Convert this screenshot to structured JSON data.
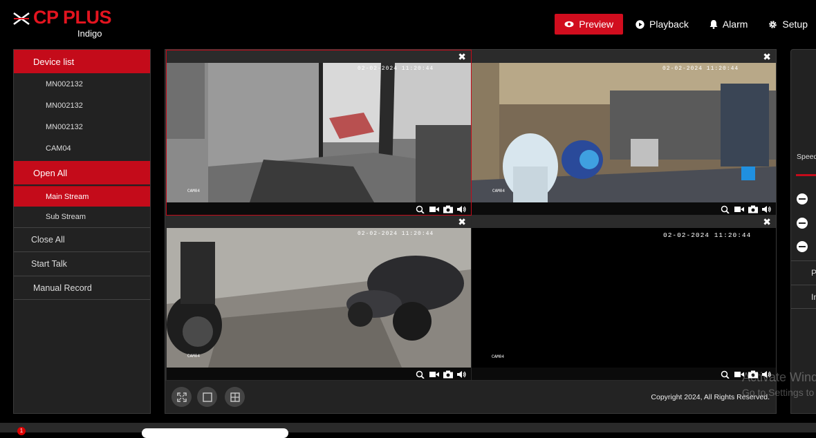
{
  "brand": {
    "name": "CP PLUS",
    "sub": "Indigo"
  },
  "nav": [
    {
      "label": "Preview",
      "icon": "eye-icon",
      "active": true
    },
    {
      "label": "Playback",
      "icon": "play-icon",
      "active": false
    },
    {
      "label": "Alarm",
      "icon": "bell-icon",
      "active": false
    },
    {
      "label": "Setup",
      "icon": "gear-icon",
      "active": false
    }
  ],
  "sidebar": {
    "device_list_label": "Device list",
    "devices": [
      "MN002132",
      "MN002132",
      "MN002132",
      "CAM04"
    ],
    "open_all_label": "Open All",
    "streams": [
      {
        "label": "Main Stream",
        "selected": true
      },
      {
        "label": "Sub Stream",
        "selected": false
      }
    ],
    "actions": [
      "Close All",
      "Start Talk",
      "Manual Record"
    ]
  },
  "panes": [
    {
      "timestamp": "02-02-2024 11:20:44",
      "cam_label": "CAM04"
    },
    {
      "timestamp": "02-02-2024 11:20:44",
      "cam_label": "CAM04"
    },
    {
      "timestamp": "02-02-2024 11:20:44",
      "cam_label": "CAM04"
    },
    {
      "timestamp": "02-02-2024 11:20:44",
      "cam_label": "CAM04"
    }
  ],
  "footer": {
    "copyright": "Copyright 2024, All Rights Reserved."
  },
  "right_panel": {
    "speed_label": "Speed",
    "row1": "P",
    "row2": "In"
  },
  "watermark": {
    "line1": "Activate Windows",
    "line2": "Go to Settings to activate Windows."
  },
  "taskbar": {
    "badge": "1"
  },
  "colors": {
    "accent": "#d10d1e",
    "panel": "#222222",
    "background": "#000000"
  }
}
